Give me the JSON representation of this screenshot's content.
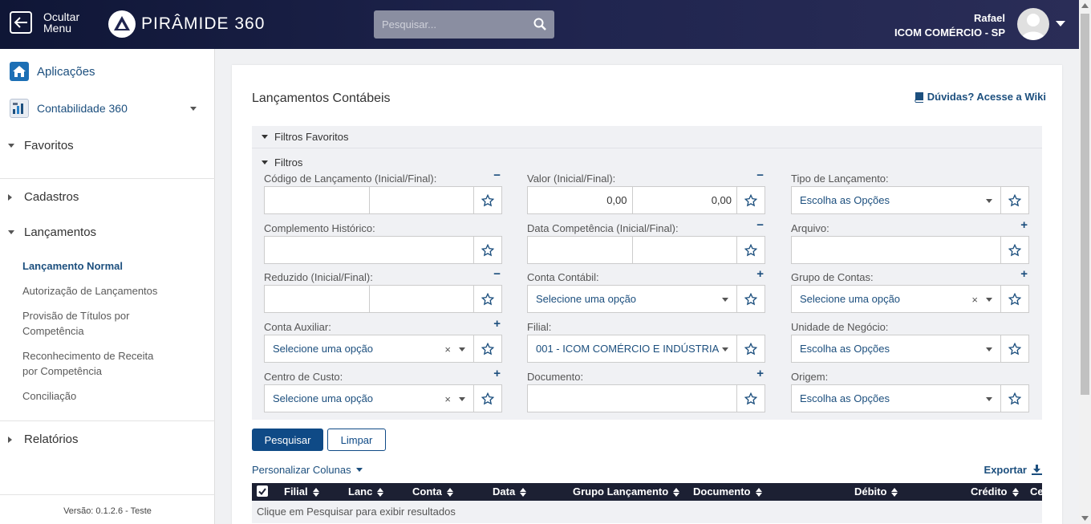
{
  "header": {
    "hide_menu_line1": "Ocultar",
    "hide_menu_line2": "Menu",
    "logo_text": "PIRÂMIDE 360",
    "search_placeholder": "Pesquisar...",
    "user_name": "Rafael",
    "user_company": "ICOM COMÉRCIO - SP"
  },
  "sidebar": {
    "app_label": "Aplicações",
    "module_label": "Contabilidade 360",
    "sections": {
      "favoritos": "Favoritos",
      "cadastros": "Cadastros",
      "lancamentos": "Lançamentos",
      "relatorios": "Relatórios"
    },
    "links": [
      "Lançamento Normal",
      "Autorização de Lançamentos",
      "Provisão de Títulos por Competência",
      "Reconhecimento de Receita por Competência",
      "Conciliação"
    ],
    "version": "Versão: 0.1.2.6 - Teste"
  },
  "main": {
    "title": "Lançamentos Contábeis",
    "wiki_link": "Dúvidas? Acesse a Wiki",
    "favorite_filters": "Filtros Favoritos",
    "filters": "Filtros",
    "fields": {
      "codigo": {
        "label": "Código de Lançamento (Inicial/Final):",
        "toggle": "−"
      },
      "valor": {
        "label": "Valor (Inicial/Final):",
        "toggle": "−",
        "initial": "0,00",
        "final": "0,00"
      },
      "tipo": {
        "label": "Tipo de Lançamento:",
        "value": "Escolha as Opções"
      },
      "complemento": {
        "label": "Complemento Histórico:"
      },
      "data_comp": {
        "label": "Data Competência (Inicial/Final):",
        "toggle": "−"
      },
      "arquivo": {
        "label": "Arquivo:",
        "toggle": "+"
      },
      "reduzido": {
        "label": "Reduzido (Inicial/Final):",
        "toggle": "−"
      },
      "conta_contabil": {
        "label": "Conta Contábil:",
        "toggle": "+",
        "value": "Selecione uma opção"
      },
      "grupo_contas": {
        "label": "Grupo de Contas:",
        "toggle": "+",
        "value": "Selecione uma opção"
      },
      "conta_auxiliar": {
        "label": "Conta Auxiliar:",
        "toggle": "+",
        "value": "Selecione uma opção"
      },
      "filial": {
        "label": "Filial:",
        "value": "001 - ICOM COMÉRCIO E INDÚSTRIA"
      },
      "unidade": {
        "label": "Unidade de Negócio:",
        "value": "Escolha as Opções"
      },
      "centro_custo": {
        "label": "Centro de Custo:",
        "toggle": "+",
        "value": "Selecione uma opção"
      },
      "documento": {
        "label": "Documento:",
        "toggle": "+"
      },
      "origem": {
        "label": "Origem:",
        "value": "Escolha as Opções"
      }
    },
    "search_button": "Pesquisar",
    "clear_button": "Limpar",
    "customize_columns": "Personalizar Colunas",
    "export": "Exportar",
    "table": {
      "columns": [
        "Filial",
        "Lanc",
        "Conta",
        "Data",
        "Grupo Lançamento",
        "Documento",
        "Débito",
        "Crédito",
        "Ce"
      ],
      "empty_message": "Clique em Pesquisar para exibir resultados"
    }
  }
}
